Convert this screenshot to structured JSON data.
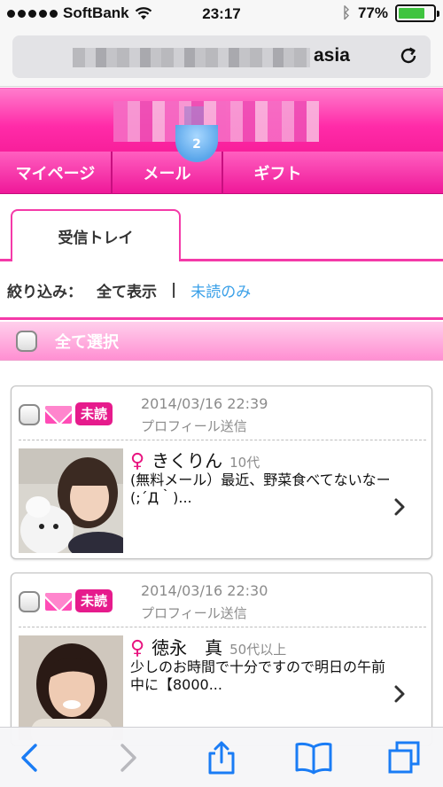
{
  "status_bar": {
    "carrier": "SoftBank",
    "time": "23:17",
    "battery": "77%",
    "battery_level": 0.77,
    "icons": [
      "signal-dots-icon",
      "wifi-icon",
      "bluetooth-icon",
      "battery-icon"
    ]
  },
  "browser": {
    "url_visible": "asia",
    "reload_icon": "reload-icon"
  },
  "nav": {
    "items": [
      {
        "label": "マイページ"
      },
      {
        "label": "メール",
        "badge": "2"
      },
      {
        "label": "ギフト"
      }
    ]
  },
  "tabs": {
    "active": "受信トレイ"
  },
  "filter": {
    "label": "絞り込み：",
    "options": [
      "全て表示",
      "未読のみ"
    ],
    "separator": "|"
  },
  "select_all": {
    "label": "全て選択"
  },
  "messages": [
    {
      "badge": "未読",
      "date": "2014/03/16 22:39",
      "type": "プロフィール送信",
      "gender_symbol": "♀",
      "name": "きくりん",
      "age": "10代",
      "preview": "(無料メール）最近、野菜食べてないなー(;´Д｀)..."
    },
    {
      "badge": "未読",
      "date": "2014/03/16 22:30",
      "type": "プロフィール送信",
      "gender_symbol": "♀",
      "name": "徳永　真",
      "age": "50代以上",
      "preview": "少しのお時間で十分ですので明日の午前中に【8000..."
    }
  ],
  "colors": {
    "brand_pink": "#f81f9b",
    "accent_blue": "#3aa0e8",
    "ios_blue": "#1a7cf5"
  }
}
